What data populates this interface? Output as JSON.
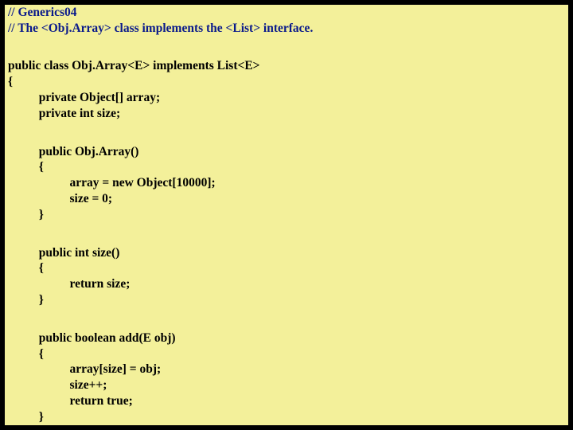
{
  "code": {
    "comment1": "// Generics04",
    "comment2": "// The <Obj.Array> class implements the <List> interface.",
    "decl": "public class Obj.Array<E> implements List<E>",
    "openBrace": "{",
    "field1": "          private Object[] array;",
    "field2": "          private int size;",
    "ctor_sig": "          public Obj.Array()",
    "ctor_open": "          {",
    "ctor_l1": "                    array = new Object[10000];",
    "ctor_l2": "                    size = 0;",
    "ctor_close": "          }",
    "size_sig": "          public int size()",
    "size_open": "          {",
    "size_l1": "                    return size;",
    "size_close": "          }",
    "add_sig": "          public boolean add(E obj)",
    "add_open": "          {",
    "add_l1": "                    array[size] = obj;",
    "add_l2": "                    size++;",
    "add_l3": "                    return true;",
    "add_close": "          }"
  }
}
